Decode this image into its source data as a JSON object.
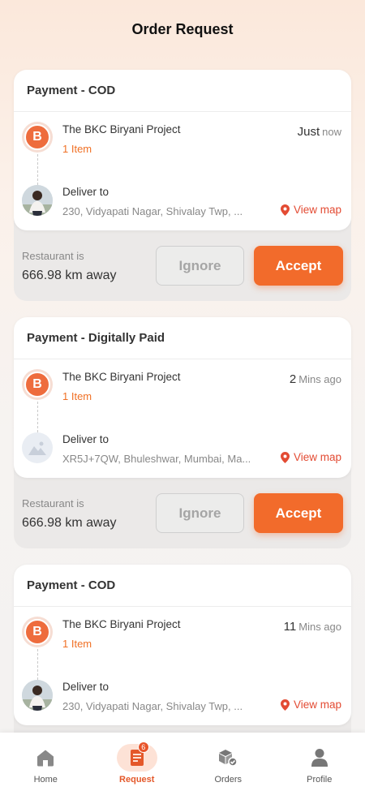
{
  "header": {
    "title": "Order Request"
  },
  "orders": [
    {
      "payment": "Payment - COD",
      "restaurant_initial": "B",
      "restaurant_name": "The BKC Biryani Project",
      "items": "1 Item",
      "time_value": "Just",
      "time_unit": "now",
      "deliver_label": "Deliver to",
      "address": "230, Vidyapati Nagar, Shivalay Twp, ...",
      "view_map": "View map",
      "distance_label": "Restaurant is",
      "distance_value": "666.98 km away",
      "ignore_label": "Ignore",
      "accept_label": "Accept",
      "avatar": "photo"
    },
    {
      "payment": "Payment - Digitally Paid",
      "restaurant_initial": "B",
      "restaurant_name": "The BKC Biryani Project",
      "items": "1 Item",
      "time_value": "2",
      "time_unit": "Mins ago",
      "deliver_label": "Deliver to",
      "address": "XR5J+7QW, Bhuleshwar, Mumbai, Ma...",
      "view_map": "View map",
      "distance_label": "Restaurant is",
      "distance_value": "666.98 km away",
      "ignore_label": "Ignore",
      "accept_label": "Accept",
      "avatar": "placeholder"
    },
    {
      "payment": "Payment - COD",
      "restaurant_initial": "B",
      "restaurant_name": "The BKC Biryani Project",
      "items": "1 Item",
      "time_value": "11",
      "time_unit": "Mins ago",
      "deliver_label": "Deliver to",
      "address": "230, Vidyapati Nagar, Shivalay Twp, ...",
      "view_map": "View map",
      "avatar": "photo"
    }
  ],
  "nav": {
    "items": [
      {
        "label": "Home",
        "icon": "home-icon"
      },
      {
        "label": "Request",
        "icon": "request-icon",
        "badge": "6",
        "active": true
      },
      {
        "label": "Orders",
        "icon": "orders-icon"
      },
      {
        "label": "Profile",
        "icon": "profile-icon"
      }
    ]
  },
  "colors": {
    "accent": "#f26b2b",
    "map_pin": "#e34b33",
    "item_text": "#f07025"
  }
}
